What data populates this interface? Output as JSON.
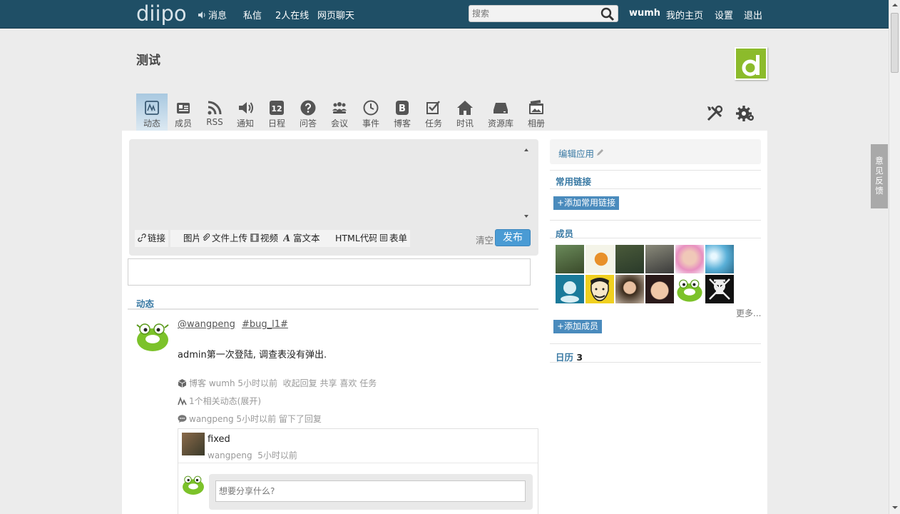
{
  "topbar": {
    "logo": "diipo",
    "messages": "消息",
    "private_msg": "私信",
    "online": "2人在线",
    "web_chat": "网页聊天",
    "search_placeholder": "搜索",
    "username": "wumh",
    "my_home": "我的主页",
    "settings": "设置",
    "logout": "退出"
  },
  "group": {
    "title": "测试"
  },
  "tabs": [
    {
      "label": "动态",
      "icon": "activity-icon"
    },
    {
      "label": "成员",
      "icon": "members-icon"
    },
    {
      "label": "RSS",
      "icon": "rss-icon"
    },
    {
      "label": "通知",
      "icon": "speaker-icon"
    },
    {
      "label": "日程",
      "icon": "calendar-icon"
    },
    {
      "label": "问答",
      "icon": "question-icon"
    },
    {
      "label": "会议",
      "icon": "meeting-icon"
    },
    {
      "label": "事件",
      "icon": "clock-icon"
    },
    {
      "label": "博客",
      "icon": "blog-icon"
    },
    {
      "label": "任务",
      "icon": "task-icon"
    },
    {
      "label": "时讯",
      "icon": "home-icon"
    },
    {
      "label": "资源库",
      "icon": "drive-icon"
    },
    {
      "label": "相册",
      "icon": "album-icon"
    }
  ],
  "calendar_day": "12",
  "composer": {
    "placeholder": "想要分享什么?",
    "tools": [
      "链接",
      "图片",
      "文件上传",
      "视频",
      "富文本",
      "HTML代码",
      "表单"
    ],
    "clear": "清空",
    "publish": "发布"
  },
  "feed": {
    "heading": "动态",
    "post": {
      "mention": "@wangpeng",
      "tag": "#bug_l1#",
      "body": "admin第一次登陆, 调查表没有弹出.",
      "meta_source": "博客",
      "meta_user": "wumh",
      "meta_time": "5小时以前",
      "actions": [
        "收起回复",
        "共享",
        "喜欢",
        "任务"
      ],
      "related": "1个相关动态(展开)",
      "reply_note": "wangpeng 5小时以前 留下了回复"
    },
    "reply": {
      "text": "fixed",
      "user": "wangpeng",
      "time": "5小时以前",
      "placeholder": "想要分享什么?"
    }
  },
  "sidebar": {
    "edit_app": "编辑应用",
    "links_heading": "常用链接",
    "add_link": "+添加常用链接",
    "members_heading": "成员",
    "more": "更多...",
    "add_member": "+添加成员",
    "calendar_heading": "日历",
    "calendar_count": "3"
  },
  "feedback": [
    "意",
    "见",
    "反",
    "馈"
  ],
  "colors": {
    "topbar": "#1f4f66",
    "accent": "#3a7aa4",
    "publish": "#4a9bd4",
    "brand_green": "#8cbb2b"
  }
}
